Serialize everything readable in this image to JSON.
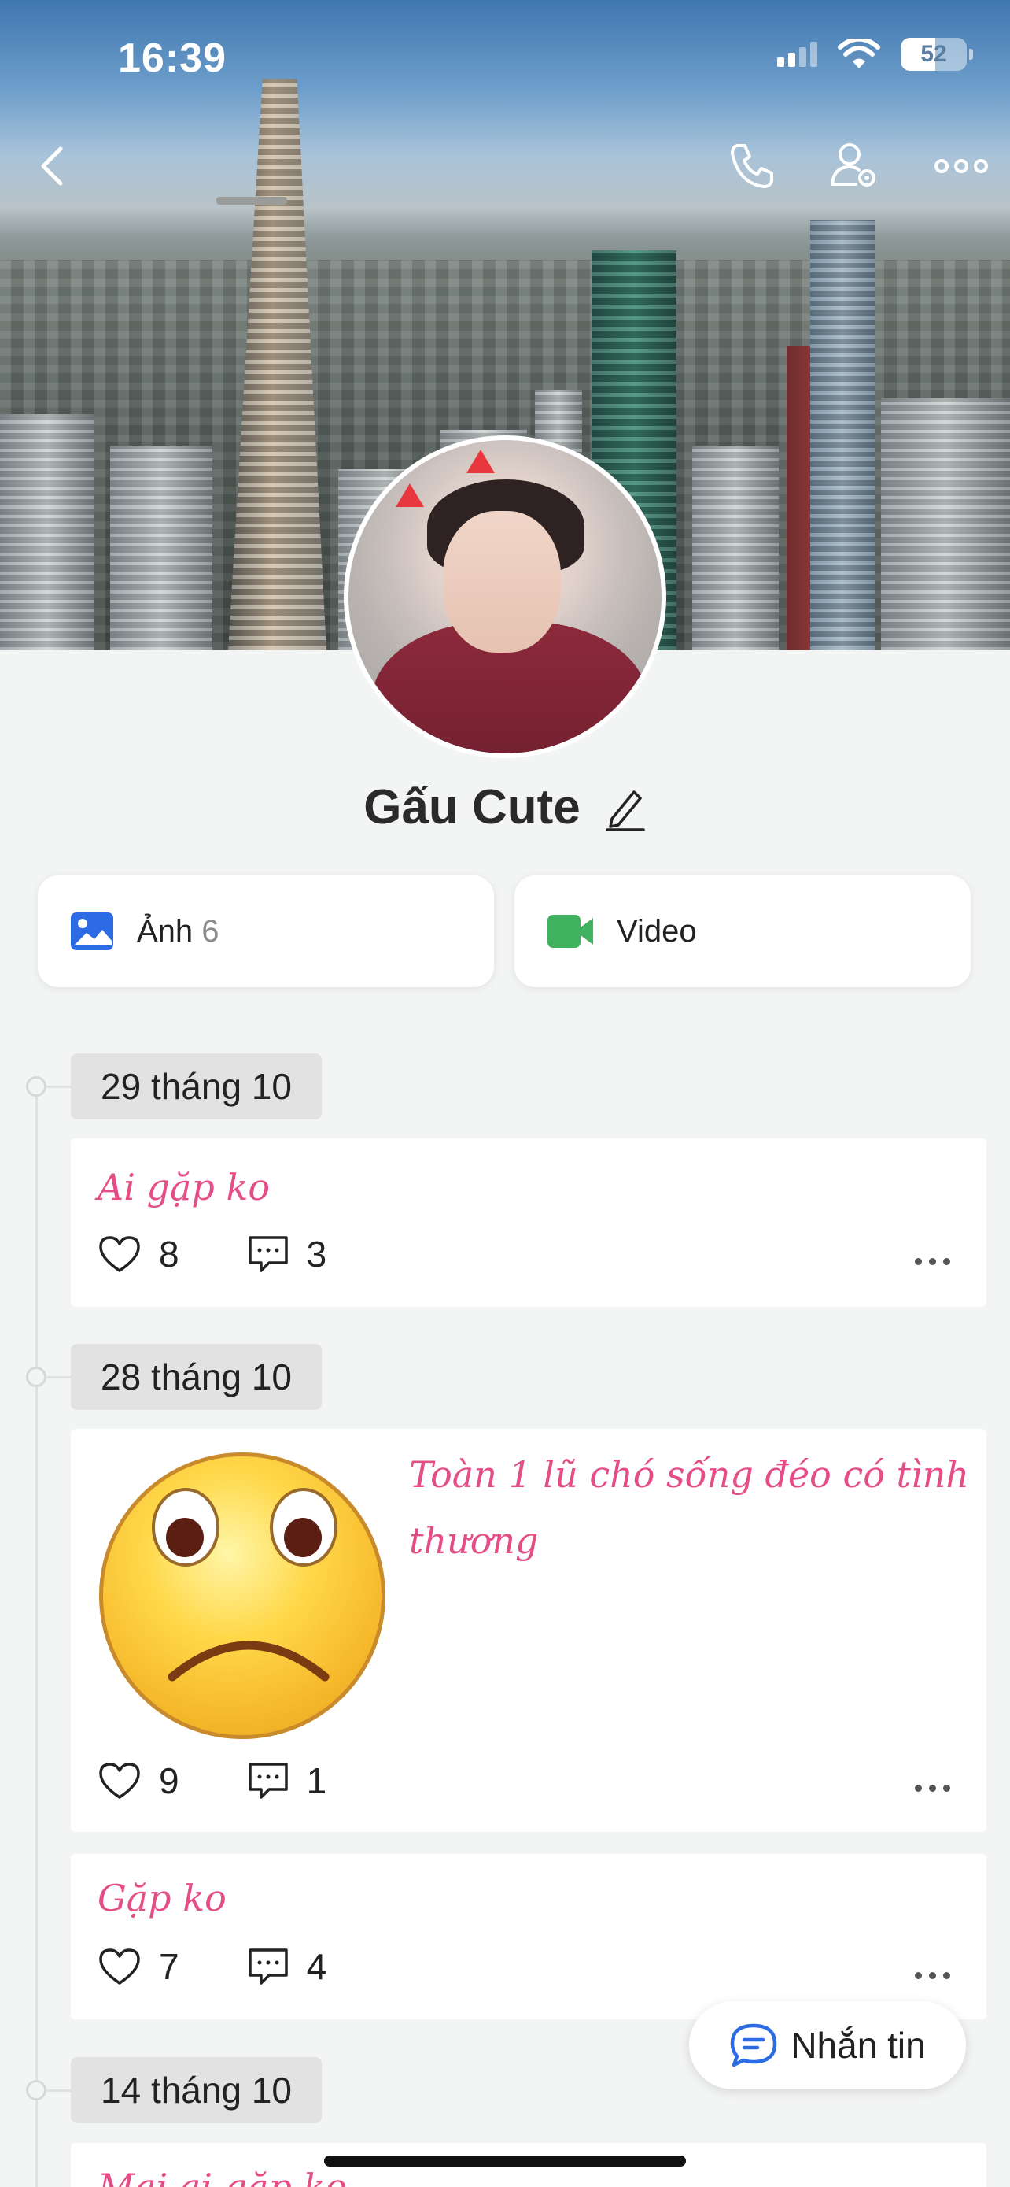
{
  "status_bar": {
    "time": "16:39",
    "battery": "52",
    "battery_level": 0.52
  },
  "header": {
    "back_icon": "chevron-left-icon",
    "call_icon": "phone-icon",
    "settings_icon": "user-gear-icon",
    "more_icon": "ellipsis-icon"
  },
  "profile": {
    "name": "Gấu Cute",
    "edit_icon": "pencil-icon"
  },
  "media": [
    {
      "label": "Ảnh",
      "count": "6",
      "icon": "photo-icon",
      "color": "#2d6be4"
    },
    {
      "label": "Video",
      "count": "",
      "icon": "video-camera-icon",
      "color": "#3fb15f"
    }
  ],
  "timeline": [
    {
      "date": "29 tháng 10"
    },
    {
      "date": "28 tháng 10"
    },
    {
      "date": "14 tháng 10"
    }
  ],
  "posts": [
    {
      "text": "Ai gặp ko",
      "likes": "8",
      "comments": "3"
    },
    {
      "text_line1": "Toàn 1 lũ chó sống đéo có tình",
      "text_line2": "thương",
      "image_icon": "sad-face-emoji",
      "likes": "9",
      "comments": "1"
    },
    {
      "text": "Gặp ko",
      "likes": "7",
      "comments": "4"
    },
    {
      "text": "Mai ai gặp ko"
    }
  ],
  "message_button": {
    "label": "Nhắn tin",
    "icon": "chat-bubble-icon"
  },
  "colors": {
    "post_text": "#e44d86",
    "background": "#f3f4f4"
  }
}
